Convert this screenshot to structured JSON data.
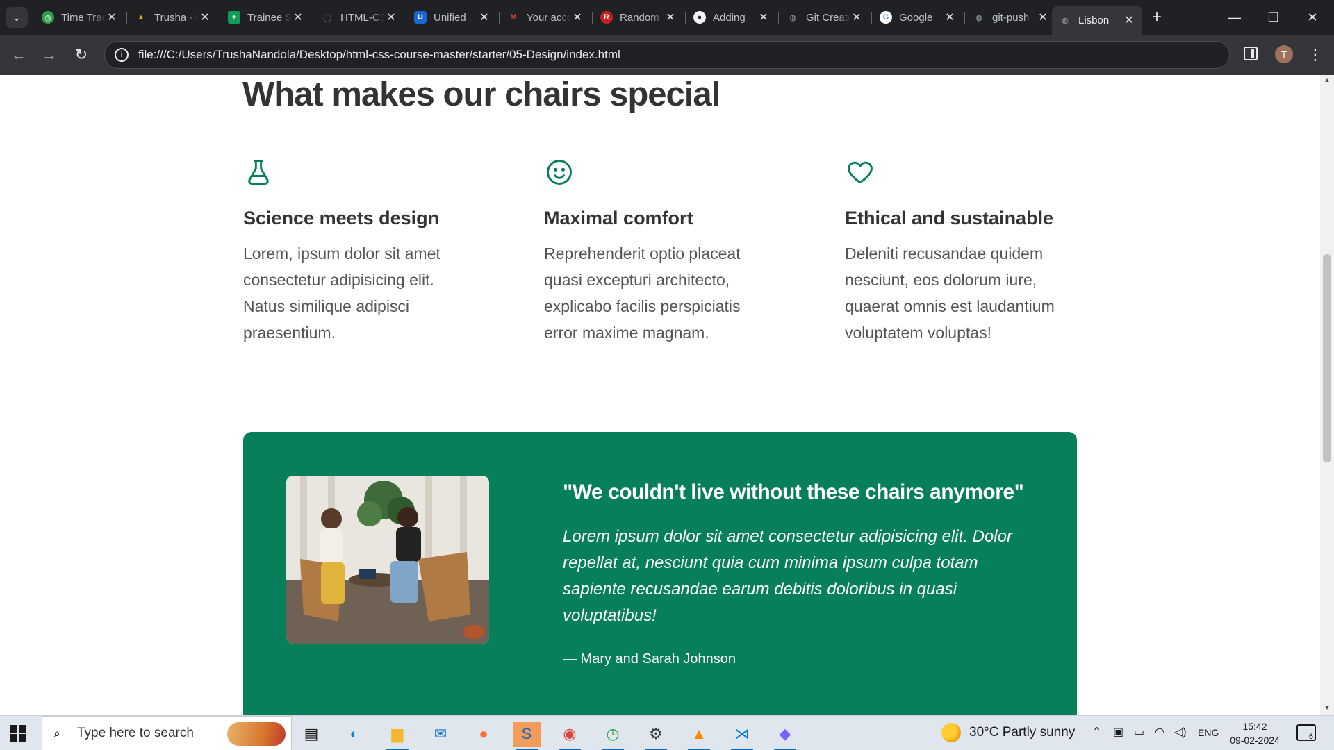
{
  "browser": {
    "tabs": [
      {
        "title": "Time Tracker",
        "favicon_color": "#2e9e47",
        "favicon_glyph": "◷"
      },
      {
        "title": "Trusha - Google Drive",
        "favicon_color": "#f4b400",
        "favicon_glyph": "▲"
      },
      {
        "title": "Trainee Sheet",
        "favicon_color": "#0f9d58",
        "favicon_glyph": "+"
      },
      {
        "title": "HTML-CSS",
        "favicon_color": "#202124",
        "favicon_glyph": "◯"
      },
      {
        "title": "Unified",
        "favicon_color": "#1967d2",
        "favicon_glyph": "U"
      },
      {
        "title": "Your account",
        "favicon_color": "#ea4335",
        "favicon_glyph": "M"
      },
      {
        "title": "Random",
        "favicon_color": "#c5221f",
        "favicon_glyph": "R"
      },
      {
        "title": "Adding",
        "favicon_color": "#24292f",
        "favicon_glyph": "●"
      },
      {
        "title": "Git Create",
        "favicon_color": "#5f6368",
        "favicon_glyph": "◍"
      },
      {
        "title": "Google",
        "favicon_color": "#4285f4",
        "favicon_glyph": "G"
      },
      {
        "title": "git-push",
        "favicon_color": "#5f6368",
        "favicon_glyph": "◍"
      },
      {
        "title": "Lisbon",
        "favicon_color": "#5f6368",
        "favicon_glyph": "◍",
        "active": true
      }
    ],
    "url": "file:///C:/Users/TrushaNandola/Desktop/html-css-course-master/starter/05-Design/index.html",
    "profile_initial": "T"
  },
  "page": {
    "section_title": "What makes our chairs special",
    "features": [
      {
        "icon": "flask-icon",
        "title": "Science meets design",
        "text": "Lorem, ipsum dolor sit amet consectetur adipisicing elit. Natus similique adipisci praesentium."
      },
      {
        "icon": "smile-icon",
        "title": "Maximal comfort",
        "text": "Reprehenderit optio placeat quasi excepturi architecto, explicabo facilis perspiciatis error maxime magnam."
      },
      {
        "icon": "heart-icon",
        "title": "Ethical and sustainable",
        "text": "Deleniti recusandae quidem nesciunt, eos dolorum iure, quaerat omnis est laudantium voluptatem voluptas!"
      }
    ],
    "testimonial": {
      "title": "\"We couldn't live without these chairs anymore\"",
      "quote": "Lorem ipsum dolor sit amet consectetur adipisicing elit. Dolor repellat at, nesciunt quia cum minima ipsum culpa totam sapiente recusandae earum debitis doloribus in quasi voluptatibus!",
      "author": "— Mary and Sarah Johnson",
      "background_color": "#087f5b"
    },
    "accent_color": "#087f5b"
  },
  "taskbar": {
    "search_placeholder": "Type here to search",
    "weather": "30°C  Partly sunny",
    "language": "ENG",
    "time": "15:42",
    "date": "09-02-2024",
    "notification_count": "6",
    "apps": [
      "task-view-icon",
      "edge-icon",
      "file-explorer-icon",
      "mail-icon",
      "firefox-icon",
      "skype-icon",
      "chrome-icon",
      "time-tracker-icon",
      "settings-icon",
      "vlc-icon",
      "vscode-icon",
      "git-client-icon"
    ]
  }
}
